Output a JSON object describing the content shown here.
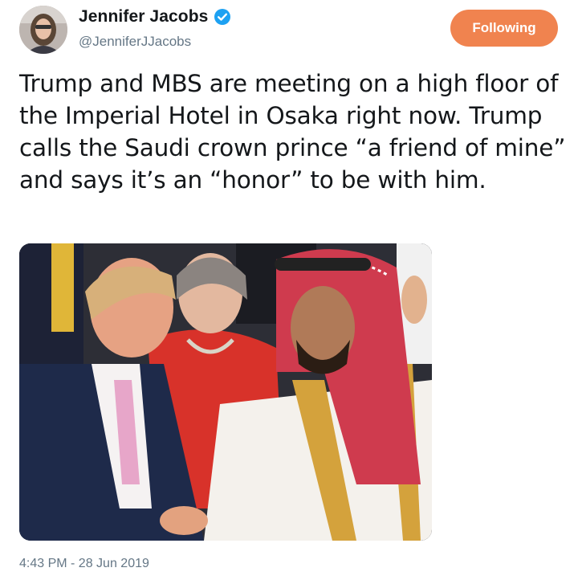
{
  "author": {
    "display_name": "Jennifer Jacobs",
    "handle": "@JenniferJJacobs",
    "verified": true,
    "avatar_icon": "profile-photo"
  },
  "follow_button": {
    "label": "Following",
    "color": "#f0834f"
  },
  "tweet": {
    "text": "Trump and MBS are meeting on a high floor of the Imperial Hotel in Osaka right now. Trump calls the Saudi crown prince “a friend of mine” and says it’s an “honor” to be with him.",
    "timestamp": "4:43 PM - 28 Jun 2019"
  },
  "media": {
    "type": "photo",
    "icon": "handshake-photo"
  },
  "colors": {
    "text_primary": "#14171a",
    "text_secondary": "#657786",
    "verified_blue": "#1da1f2"
  }
}
